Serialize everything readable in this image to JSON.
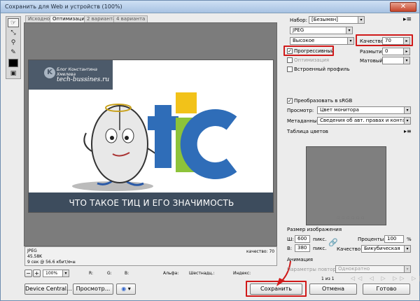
{
  "window": {
    "title": "Сохранить для Web и устройств (100%)",
    "close_icon": "close-icon"
  },
  "tabs": [
    "Исходное",
    "Оптимизация",
    "2 варианта",
    "4 варианта"
  ],
  "image": {
    "blog_text": "Блог Константина Хмелева",
    "site_text": "tech-bussines.ru",
    "logo_letter": "K",
    "word": "tic",
    "caption": "ЧТО ТАКОЕ ТИЦ И ЕГО ЗНАЧИМОСТЬ"
  },
  "status": {
    "format": "JPEG",
    "size": "45.58K",
    "time": "9 сек @ 56.6 кбит/с",
    "menu": "⇒≡",
    "quality": "качество: 70"
  },
  "zoom": {
    "value": "100%",
    "minus": "−",
    "plus": "+"
  },
  "readouts": {
    "r": "R:",
    "g": "G:",
    "b": "B:",
    "alpha": "Альфа:",
    "hex": "Шестнадц.:",
    "index": "Индекс:"
  },
  "buttons": {
    "device_central": "Device Central...",
    "preview": "Просмотр...",
    "save": "Сохранить",
    "cancel": "Отмена",
    "done": "Готово"
  },
  "settings": {
    "preset_label": "Набор:",
    "preset_value": "[Безымян]",
    "format_value": "JPEG",
    "quality_level": "Высокое",
    "quality_label": "Качество:",
    "quality_value": "70",
    "progressive_label": "Прогрессивный",
    "optimization_label": "Оптимизация",
    "blur_label": "Размытие:",
    "blur_value": "0",
    "matte_label": "Матовый:",
    "icc_label": "Встроенный профиль",
    "srgb_label": "Преобразовать в sRGB",
    "preview_label": "Просмотр:",
    "preview_value": "Цвет монитора",
    "meta_label": "Метаданные:",
    "meta_value": "Сведения об авт. правах и контакты",
    "color_table_label": "Таблица цветов",
    "size_section_label": "Размер изображения",
    "w_label": "Ш:",
    "w_value": "600",
    "h_label": "В:",
    "h_value": "380",
    "px_label": "пикс.",
    "percent_label": "Проценты:",
    "percent_value": "100",
    "percent_unit": "%",
    "quality2_label": "Качество:",
    "quality2_value": "Бикубическая",
    "animation_label": "Анимация",
    "loop_label": "Параметры повторов:",
    "loop_value": "Однократно",
    "frame_counter": "1 из 1"
  },
  "colors": {
    "accent_red": "#d01a1a",
    "image_dark": "#3d4c5d"
  }
}
